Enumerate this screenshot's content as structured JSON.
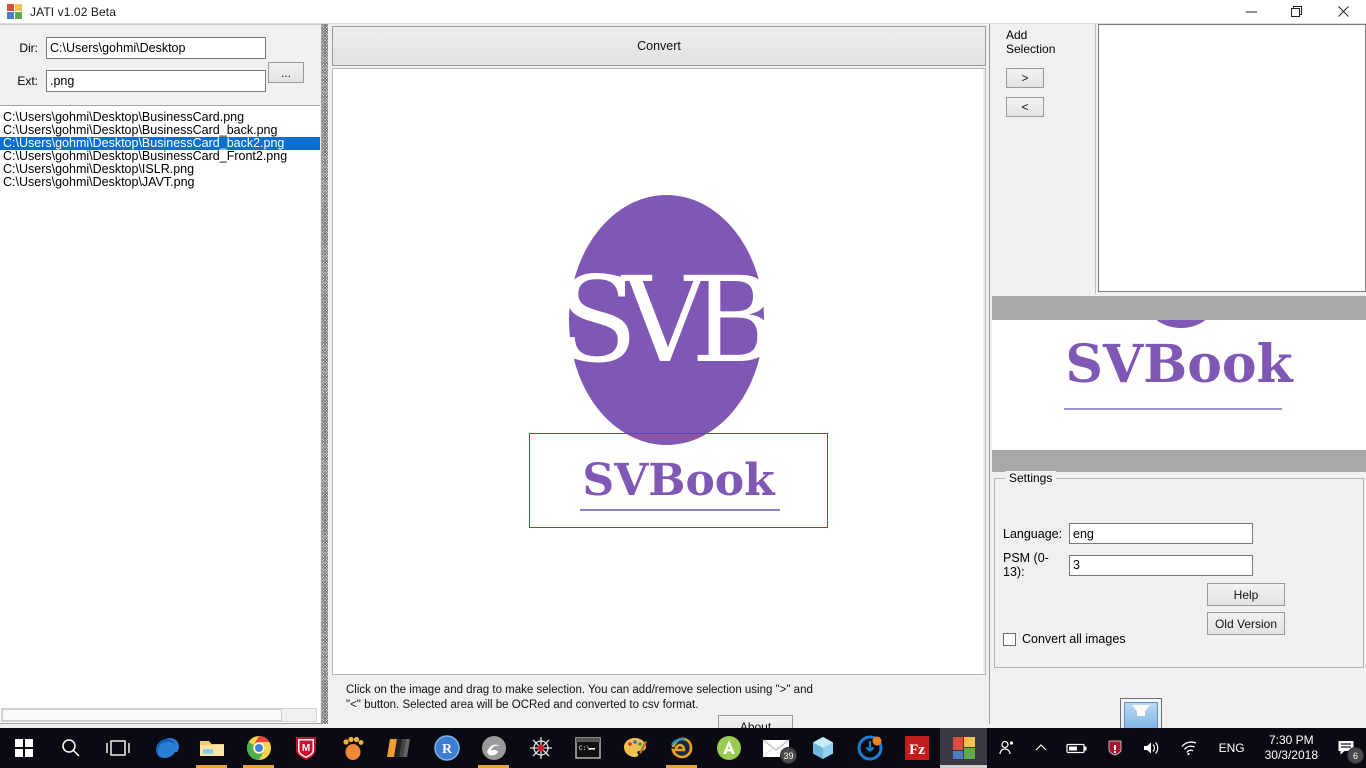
{
  "window": {
    "title": "JATI v1.02 Beta",
    "icon": "app-tiles-icon",
    "minimize": "–",
    "maximize": "❐",
    "close": "✕"
  },
  "left_panel": {
    "dir_label": "Dir:",
    "dir_value": "C:\\Users\\gohmi\\Desktop",
    "browse_label": "...",
    "ext_label": "Ext:",
    "ext_value": ".png",
    "files": [
      {
        "path": "C:\\Users\\gohmi\\Desktop\\BusinessCard.png",
        "selected": false
      },
      {
        "path": "C:\\Users\\gohmi\\Desktop\\BusinessCard_back.png",
        "selected": false
      },
      {
        "path": "C:\\Users\\gohmi\\Desktop\\BusinessCard_back2.png",
        "selected": true
      },
      {
        "path": "C:\\Users\\gohmi\\Desktop\\BusinessCard_Front2.png",
        "selected": false
      },
      {
        "path": "C:\\Users\\gohmi\\Desktop\\ISLR.png",
        "selected": false
      },
      {
        "path": "C:\\Users\\gohmi\\Desktop\\JAVT.png",
        "selected": false
      }
    ]
  },
  "center": {
    "convert_label": "Convert",
    "image": {
      "monogram": "SVB",
      "wordmark": "SVBook",
      "logo_color": "#7f57b4",
      "selection_color": "#c1272d"
    },
    "hint": "Click on the image and drag to make selection. You can add/remove selection using \">\" and \"<\" button. Selected area will be OCRed and converted to csv format.",
    "about_label": "About"
  },
  "right_panel": {
    "add_selection_label": "Add\nSelection",
    "add_button": ">",
    "remove_button": "<",
    "preview_wordmark": "SVBook",
    "settings": {
      "group_title": "Settings",
      "language_label": "Language:",
      "language_value": "eng",
      "psm_label": "PSM (0-13):",
      "psm_value": "3",
      "help_label": "Help",
      "old_version_label": "Old Version",
      "convert_all_label": "Convert all images",
      "convert_all_checked": false
    }
  },
  "taskbar": {
    "items": [
      {
        "name": "start-button",
        "icon": "windows-logo-icon",
        "running": false,
        "active": false
      },
      {
        "name": "search-button",
        "icon": "search-icon",
        "running": false,
        "active": false
      },
      {
        "name": "task-view-button",
        "icon": "task-view-icon",
        "running": false,
        "active": false
      },
      {
        "name": "edge-button",
        "icon": "edge-icon",
        "running": false,
        "active": false
      },
      {
        "name": "file-explorer-button",
        "icon": "folder-icon",
        "running": true,
        "active": false
      },
      {
        "name": "chrome-button",
        "icon": "chrome-icon",
        "running": true,
        "active": false
      },
      {
        "name": "mcafee-button",
        "icon": "shield-m-icon",
        "running": false,
        "active": false
      },
      {
        "name": "gnome-button",
        "icon": "foot-icon",
        "running": false,
        "active": false
      },
      {
        "name": "stack-button",
        "icon": "layers-icon",
        "running": false,
        "active": false
      },
      {
        "name": "rstudio-button",
        "icon": "r-circle-icon",
        "running": false,
        "active": false
      },
      {
        "name": "swirl-button",
        "icon": "swirl-icon",
        "running": true,
        "active": false
      },
      {
        "name": "spider-button",
        "icon": "spider-icon",
        "running": false,
        "active": false
      },
      {
        "name": "command-prompt-button",
        "icon": "terminal-icon",
        "running": false,
        "active": false
      },
      {
        "name": "paint-button",
        "icon": "palette-icon",
        "running": false,
        "active": false
      },
      {
        "name": "internet-explorer-button",
        "icon": "ie-icon",
        "running": true,
        "active": false
      },
      {
        "name": "android-studio-button",
        "icon": "android-a-icon",
        "running": false,
        "active": false
      },
      {
        "name": "mail-button",
        "icon": "envelope-icon",
        "running": false,
        "active": false,
        "badge": "39"
      },
      {
        "name": "virtualbox-button",
        "icon": "cube-icon",
        "running": false,
        "active": false
      },
      {
        "name": "idm-button",
        "icon": "idm-circle-icon",
        "running": false,
        "active": false
      },
      {
        "name": "filezilla-button",
        "icon": "filezilla-icon",
        "running": false,
        "active": false
      },
      {
        "name": "jati-button",
        "icon": "app-tiles-icon",
        "running": false,
        "active": true
      }
    ],
    "tray": {
      "people_icon": "people-icon",
      "chevron_icon": "chevron-up-icon",
      "battery_icon": "battery-icon",
      "security_icon": "security-shield-icon",
      "volume_icon": "volume-icon",
      "network_icon": "wifi-icon",
      "language": "ENG",
      "time": "7:30 PM",
      "date": "30/3/2018",
      "notification_icon": "notification-icon",
      "notification_count": "6"
    }
  }
}
